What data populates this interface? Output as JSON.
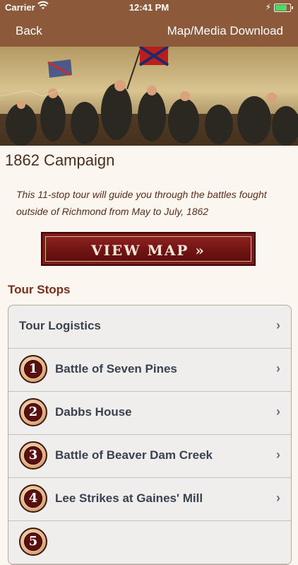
{
  "status": {
    "carrier": "Carrier",
    "time": "12:41 PM",
    "battery_level": 0.9,
    "wifi_icon": "wifi-icon"
  },
  "nav": {
    "back": "Back",
    "download": "Map/Media Download"
  },
  "page": {
    "title": "1862 Campaign",
    "description": "This 11-stop tour will guide you through the battles fought outside of Richmond from May to July, 1862",
    "view_map": "VIEW MAP »",
    "section_title": "Tour Stops"
  },
  "stops": [
    {
      "label": "Tour Logistics"
    },
    {
      "number": "1",
      "label": "Battle of Seven Pines"
    },
    {
      "number": "2",
      "label": "Dabbs House"
    },
    {
      "number": "3",
      "label": "Battle of Beaver Dam Creek"
    },
    {
      "number": "4",
      "label": "Lee Strikes at Gaines' Mill"
    },
    {
      "number": "5",
      "label": ""
    }
  ],
  "colors": {
    "nav_bg": "#8c5a3a",
    "title": "#4a2e1f",
    "section": "#7a2e1c",
    "button_bg": "#7a1a1a"
  }
}
